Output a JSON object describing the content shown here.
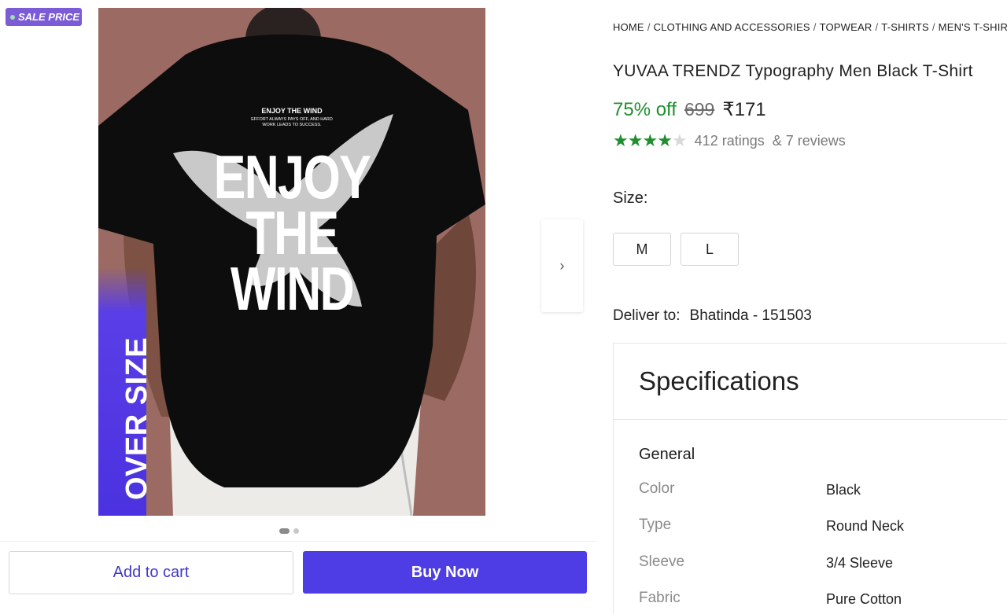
{
  "badge": {
    "label": "SALE PRICE"
  },
  "product_image": {
    "strip_text": "OVER SIZE",
    "print_title": "ENJOY THE WIND",
    "print_subtitle": "EFFORT ALWAYS PAYS OFF, AND HARD WORK LEADS TO SUCCESS.",
    "big_line_1": "ENJOY",
    "big_line_2": "THE",
    "big_line_3": "WIND",
    "next_icon": "chevron-right-icon",
    "next_glyph": "›",
    "dot_count": 2,
    "active_dot": 0
  },
  "actions": {
    "add_to_cart": "Add to cart",
    "buy_now": "Buy Now"
  },
  "breadcrumb": [
    "HOME",
    "CLOTHING AND ACCESSORIES",
    "TOPWEAR",
    "T-SHIRTS",
    "MEN'S T-SHIRTS"
  ],
  "breadcrumb_separator": "/",
  "product": {
    "title": "YUVAA TRENDZ Typography Men Black T-Shirt",
    "discount": "75% off",
    "mrp": "699",
    "price": "₹171",
    "rating_stars": 4,
    "rating_max": 5,
    "ratings_text": "412 ratings",
    "reviews_text": "& 7 reviews"
  },
  "size": {
    "label": "Size:",
    "options": [
      "M",
      "L"
    ]
  },
  "delivery": {
    "label": "Deliver to:",
    "location": "Bhatinda - 151503"
  },
  "specifications": {
    "title": "Specifications",
    "group": "General",
    "rows": [
      {
        "key": "Color",
        "value": "Black"
      },
      {
        "key": "Type",
        "value": "Round Neck"
      },
      {
        "key": "Sleeve",
        "value": "3/4 Sleeve"
      },
      {
        "key": "Fabric",
        "value": "Pure Cotton"
      }
    ]
  },
  "colors": {
    "accent": "#4e3de4",
    "discount_green": "#1f8f2e",
    "badge_purple": "#7c5cd6",
    "image_background": "#9b6a63"
  }
}
